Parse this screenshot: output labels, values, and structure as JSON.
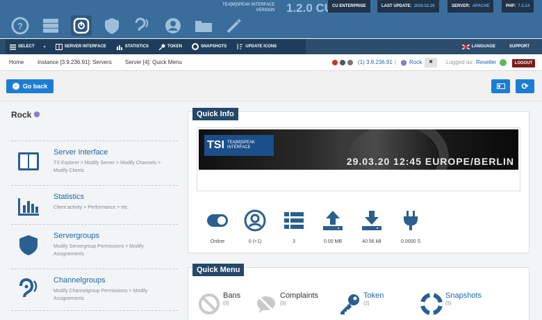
{
  "header": {
    "brand_line1": "TEA[M]SPEAK INTERFACE",
    "brand_line2": "VERSION",
    "version": "1.2.0 CU",
    "edition": "CU ENTERPRISE",
    "last_update_label": "LAST UPDATE:",
    "last_update_value": "2020.02.26",
    "server_label": "SERVER:",
    "server_value": "APACHE",
    "php_label": "PHP:",
    "php_value": "7.3.14",
    "nav_icons": [
      "help-icon",
      "server-rack-icon",
      "teamspeak-icon",
      "shield-icon",
      "ear-icon",
      "user-icon",
      "folder-icon",
      "magic-wand-icon"
    ]
  },
  "menu": {
    "items": [
      "SELECT",
      "SERVER INTERFACE",
      "STATISTICS",
      "TOKEN",
      "SNAPSHOTS",
      "UPDATE ICONS"
    ],
    "language": "LANGUAGE",
    "support": "SUPPORT"
  },
  "breadcrumb": {
    "home": "Home",
    "instance": "Instance [3.9.236.91]: Servers",
    "server": "Server [4]: Quick Menu",
    "address": "(1) 3.9.236.91",
    "server_name": "Rock",
    "close_mark": "✖",
    "logged_as_label": "Logged as:",
    "user": "Reseller",
    "logout": "LOGOUT"
  },
  "toolbar": {
    "back": "Go back"
  },
  "sidebar": {
    "title": "Rock",
    "items": [
      {
        "title": "Server Interface",
        "desc": "TS Explorer > Modify Server > Modify Channels > Modify Clients"
      },
      {
        "title": "Statistics",
        "desc": "Client activity > Performance > etc."
      },
      {
        "title": "Servergroups",
        "desc": "Modify Servergroup Permissions > Modify Assignements"
      },
      {
        "title": "Channelgroups",
        "desc": "Modify Channelgroup Permissions > Modify Assignements"
      }
    ]
  },
  "quick_info": {
    "title": "Quick Info",
    "banner_logo_big": "TSI",
    "banner_logo_small1": "TEA[M]SPEAK",
    "banner_logo_small2": "INTERFACE",
    "banner_date": "29.03.20 12:45 EUROPE/BERLIN",
    "stats": [
      {
        "icon": "toggle-on-icon",
        "label": "Online"
      },
      {
        "icon": "user-circle-icon",
        "label": "0 (+1)"
      },
      {
        "icon": "list-icon",
        "label": "3"
      },
      {
        "icon": "upload-icon",
        "label": "0.00 MB"
      },
      {
        "icon": "download-icon",
        "label": "40.56 kB"
      },
      {
        "icon": "plug-icon",
        "label": "0.0000 S"
      }
    ]
  },
  "quick_menu": {
    "title": "Quick Menu",
    "items": [
      {
        "label": "Bans",
        "count": "(0)",
        "icon": "ban-icon"
      },
      {
        "label": "Complaints",
        "count": "(0)",
        "icon": "comment-slash-icon"
      },
      {
        "label": "Token",
        "count": "(2)",
        "icon": "key-icon"
      },
      {
        "label": "Snapshots",
        "count": "(5)",
        "icon": "life-ring-icon"
      }
    ]
  },
  "colors": {
    "header_bg": "#3a6d9c",
    "menu_bg": "#2c4d6d",
    "accent_blue": "#1d7dd4",
    "panel_title_bg": "#24486a",
    "icon_dark": "#2a5f8f"
  }
}
